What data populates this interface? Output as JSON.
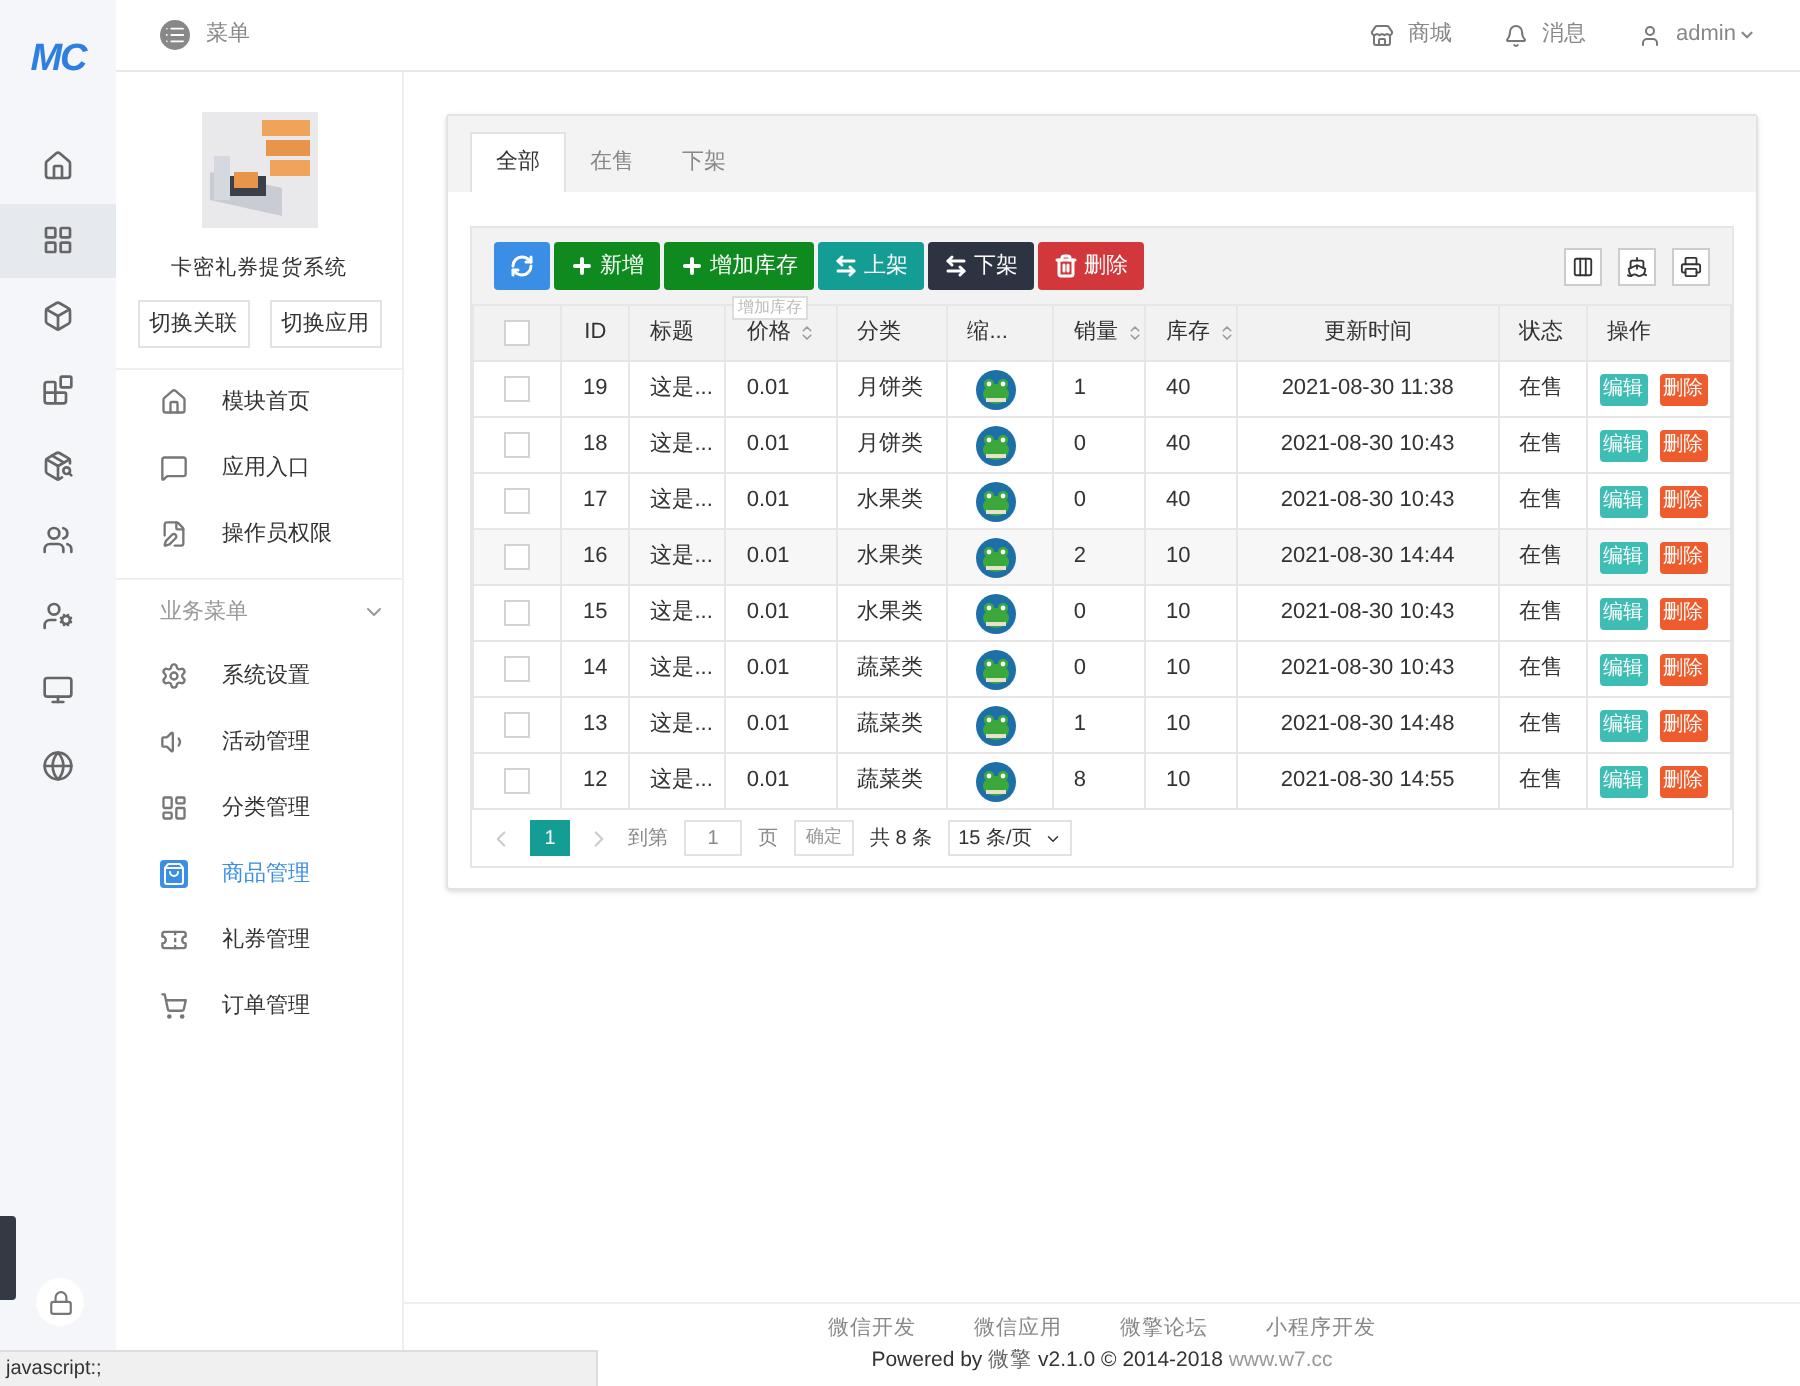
{
  "logo": "MC",
  "rail": [
    {
      "kind": "home",
      "selected": false
    },
    {
      "kind": "grid",
      "selected": true
    },
    {
      "kind": "box",
      "selected": false
    },
    {
      "kind": "apps",
      "selected": false
    },
    {
      "kind": "package",
      "selected": false
    },
    {
      "kind": "users",
      "selected": false
    },
    {
      "kind": "userlock",
      "selected": false
    },
    {
      "kind": "monitor",
      "selected": false
    },
    {
      "kind": "globe",
      "selected": false
    }
  ],
  "topbar": {
    "menu": "菜单",
    "links": [
      {
        "kind": "store",
        "label": "商城"
      },
      {
        "kind": "bell",
        "label": "消息"
      },
      {
        "kind": "user",
        "label": "admin"
      }
    ]
  },
  "app": {
    "name": "卡密礼券提货系统",
    "buttons": [
      "切换关联",
      "切换应用"
    ]
  },
  "menu": [
    {
      "kind": "home",
      "label": "模块首页",
      "selected": false
    },
    {
      "kind": "chat",
      "label": "应用入口",
      "selected": false
    },
    {
      "kind": "doc",
      "label": "操作员权限",
      "selected": false
    }
  ],
  "group": {
    "title": "业务菜单",
    "expanded": true,
    "items": [
      {
        "kind": "gear",
        "label": "系统设置",
        "selected": false
      },
      {
        "kind": "speaker",
        "label": "活动管理",
        "selected": false
      },
      {
        "kind": "layout",
        "label": "分类管理",
        "selected": false
      },
      {
        "kind": "bag",
        "label": "商品管理",
        "selected": true
      },
      {
        "kind": "ticket",
        "label": "礼券管理",
        "selected": false
      },
      {
        "kind": "cart",
        "label": "订单管理",
        "selected": false
      }
    ]
  },
  "tabs": [
    {
      "label": "全部",
      "selected": true
    },
    {
      "label": "在售",
      "selected": false
    },
    {
      "label": "下架",
      "selected": false
    }
  ],
  "toolbar": [
    {
      "kind": "refresh",
      "color": "#3a8ee6"
    },
    {
      "kind": "add",
      "label": "新增",
      "color": "#0f8a1f"
    },
    {
      "kind": "add",
      "label": "增加库存",
      "color": "#0f8a1f"
    },
    {
      "kind": "swap",
      "label": "上架",
      "color": "#139d94"
    },
    {
      "kind": "swap",
      "label": "下架",
      "color": "#2d3340"
    },
    {
      "kind": "trash",
      "label": "删除",
      "color": "#d2373b"
    }
  ],
  "tooltip": "增加库存",
  "select_all_checked": false,
  "columns": [
    {
      "label": "ID",
      "sortable": false
    },
    {
      "label": "标题",
      "sortable": false
    },
    {
      "label": "价格",
      "sortable": true
    },
    {
      "label": "分类",
      "sortable": false
    },
    {
      "label": "缩...",
      "sortable": false
    },
    {
      "label": "销量",
      "sortable": true
    },
    {
      "label": "库存",
      "sortable": true
    },
    {
      "label": "更新时间",
      "sortable": false
    },
    {
      "label": "状态",
      "sortable": false
    },
    {
      "label": "操作",
      "sortable": false
    }
  ],
  "rows": [
    {
      "id": "19",
      "title": "这是...",
      "price": "0.01",
      "category": "月饼类",
      "sales": "1",
      "stock": "40",
      "time": "2021-08-30 11:38",
      "status": "在售",
      "actions": [
        "编辑",
        "删除"
      ],
      "checked": false
    },
    {
      "id": "18",
      "title": "这是...",
      "price": "0.01",
      "category": "月饼类",
      "sales": "0",
      "stock": "40",
      "time": "2021-08-30 10:43",
      "status": "在售",
      "actions": [
        "编辑",
        "删除"
      ],
      "checked": false
    },
    {
      "id": "17",
      "title": "这是...",
      "price": "0.01",
      "category": "水果类",
      "sales": "0",
      "stock": "40",
      "time": "2021-08-30 10:43",
      "status": "在售",
      "actions": [
        "编辑",
        "删除"
      ],
      "checked": false
    },
    {
      "id": "16",
      "title": "这是...",
      "price": "0.01",
      "category": "水果类",
      "sales": "2",
      "stock": "10",
      "time": "2021-08-30 14:44",
      "status": "在售",
      "actions": [
        "编辑",
        "删除"
      ],
      "checked": false
    },
    {
      "id": "15",
      "title": "这是...",
      "price": "0.01",
      "category": "水果类",
      "sales": "0",
      "stock": "10",
      "time": "2021-08-30 10:43",
      "status": "在售",
      "actions": [
        "编辑",
        "删除"
      ],
      "checked": false
    },
    {
      "id": "14",
      "title": "这是...",
      "price": "0.01",
      "category": "蔬菜类",
      "sales": "0",
      "stock": "10",
      "time": "2021-08-30 10:43",
      "status": "在售",
      "actions": [
        "编辑",
        "删除"
      ],
      "checked": false
    },
    {
      "id": "13",
      "title": "这是...",
      "price": "0.01",
      "category": "蔬菜类",
      "sales": "1",
      "stock": "10",
      "time": "2021-08-30 14:48",
      "status": "在售",
      "actions": [
        "编辑",
        "删除"
      ],
      "checked": false
    },
    {
      "id": "12",
      "title": "这是...",
      "price": "0.01",
      "category": "蔬菜类",
      "sales": "8",
      "stock": "10",
      "time": "2021-08-30 14:55",
      "status": "在售",
      "actions": [
        "编辑",
        "删除"
      ],
      "checked": false
    }
  ],
  "pagination": {
    "pages": [
      {
        "label": "1",
        "selected": true
      }
    ],
    "goto": "到第",
    "page_value": "1",
    "page_unit": "页",
    "confirm": "确定",
    "total": "共 8 条",
    "page_size": "15 条/页"
  },
  "footer": {
    "links": [
      "微信开发",
      "微信应用",
      "微擎论坛",
      "小程序开发"
    ],
    "powered": "Powered by",
    "brand": "微擎",
    "version": "v2.1.0 © 2014-2018",
    "site": "www.w7.cc"
  },
  "status_bar": "javascript:;"
}
